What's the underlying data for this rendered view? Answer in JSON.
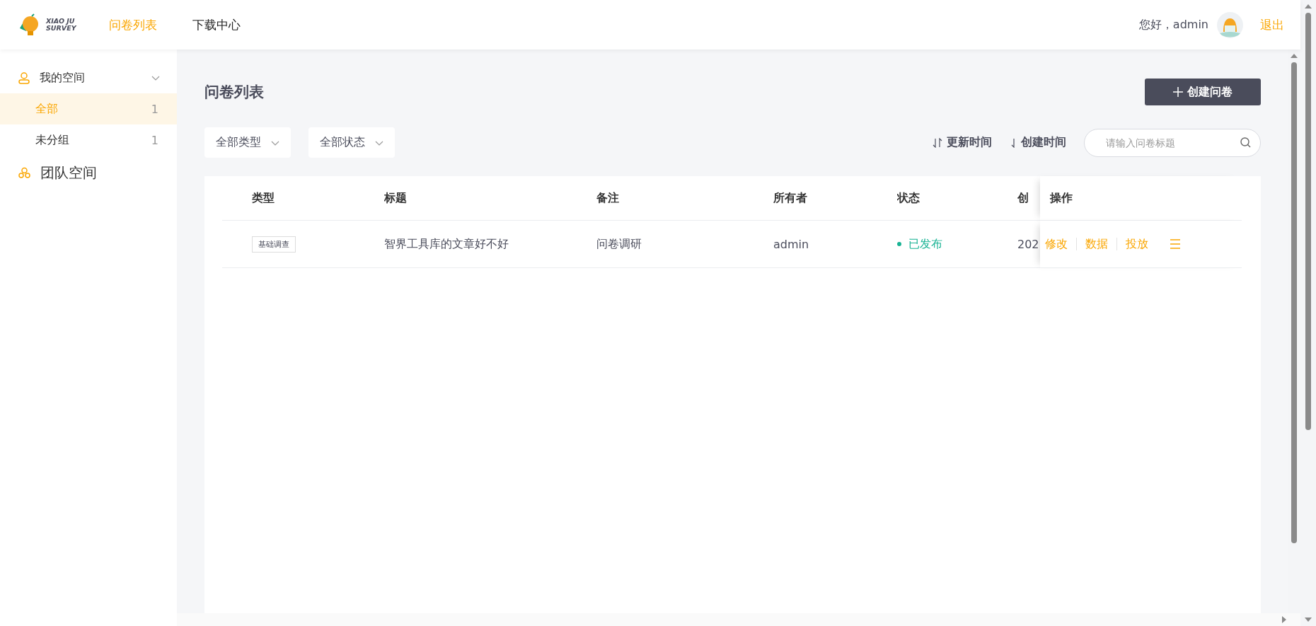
{
  "header": {
    "logo_text": [
      "XIAO JU",
      "SURVEY"
    ],
    "nav": [
      {
        "label": "问卷列表",
        "selected": true
      },
      {
        "label": "下载中心",
        "selected": false
      }
    ],
    "greeting": "您好，admin",
    "logout": "退出"
  },
  "sidebar": {
    "sections": [
      {
        "kind": "personal",
        "label": "我的空间",
        "expanded": true,
        "children": [
          {
            "label": "全部",
            "count": "1",
            "selected": true
          },
          {
            "label": "未分组",
            "count": "1",
            "selected": false
          }
        ]
      },
      {
        "kind": "team",
        "label": "团队空间"
      }
    ]
  },
  "page_title": "问卷列表",
  "create_button": "创建问卷",
  "filters": [
    {
      "label": "全部类型"
    },
    {
      "label": "全部状态"
    }
  ],
  "sorts": [
    {
      "kind": "both",
      "label": "更新时间"
    },
    {
      "kind": "down",
      "label": "创建时间"
    }
  ],
  "search": {
    "placeholder": "请输入问卷标题"
  },
  "table": {
    "columns": [
      "类型",
      "标题",
      "备注",
      "所有者",
      "状态",
      "创"
    ],
    "action_column": "操作",
    "rows": [
      {
        "type": "基础调查",
        "title": "智界工具库的文章好不好",
        "note": "问卷调研",
        "owner": "admin",
        "status": {
          "label": "已发布",
          "color": "#19b394"
        },
        "created": "202",
        "actions": [
          "修改",
          "数据",
          "投放"
        ]
      }
    ]
  }
}
